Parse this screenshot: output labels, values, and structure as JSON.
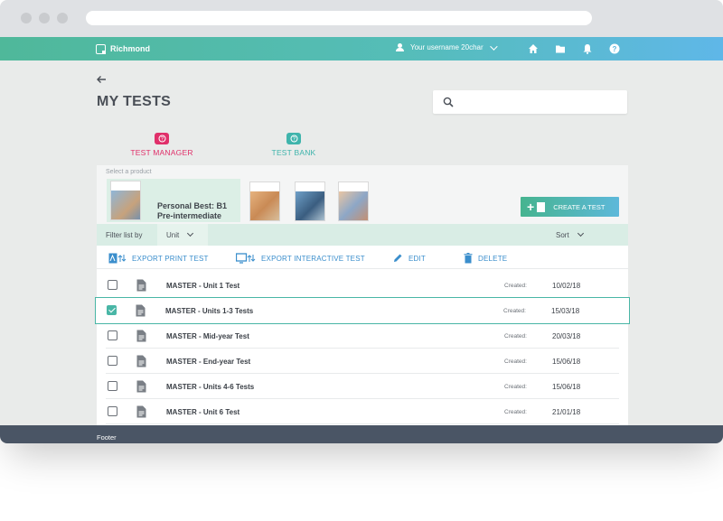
{
  "header": {
    "brand": "Richmond",
    "username": "Your username 20char"
  },
  "page": {
    "title": "MY TESTS"
  },
  "tabs": {
    "manager": "TEST MANAGER",
    "bank": "TEST BANK"
  },
  "product": {
    "select_label": "Select a product",
    "selected_name_line1": "Personal Best: B1",
    "selected_name_line2": "Pre-intermediate"
  },
  "create_button": "CREATE A TEST",
  "filter": {
    "label": "Filter list by",
    "unit_value": "Unit",
    "sort_value": "Sort"
  },
  "actions": {
    "export_print": "EXPORT PRINT TEST",
    "export_interactive": "EXPORT INTERACTIVE TEST",
    "edit": "EDIT",
    "delete": "DELETE"
  },
  "tests": [
    {
      "name": "MASTER - Unit 1 Test",
      "created_label": "Created:",
      "date": "10/02/18",
      "selected": false
    },
    {
      "name": "MASTER - Units 1-3 Tests",
      "created_label": "Created:",
      "date": "15/03/18",
      "selected": true
    },
    {
      "name": "MASTER - Mid-year Test",
      "created_label": "Created:",
      "date": "20/03/18",
      "selected": false
    },
    {
      "name": "MASTER - End-year Test",
      "created_label": "Created:",
      "date": "15/06/18",
      "selected": false
    },
    {
      "name": "MASTER - Units 4-6 Tests",
      "created_label": "Created:",
      "date": "15/06/18",
      "selected": false
    },
    {
      "name": "MASTER - Unit 6 Test",
      "created_label": "Created:",
      "date": "21/01/18",
      "selected": false
    }
  ],
  "footer": {
    "text": "Footer"
  },
  "colors": {
    "accent_green": "#49b6a6",
    "test_manager_pink": "#e0306a",
    "action_blue": "#3a8ecc"
  }
}
